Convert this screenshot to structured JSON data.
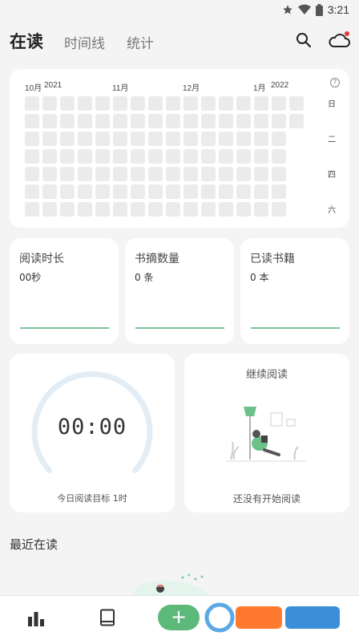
{
  "status_bar": {
    "time": "3:21"
  },
  "header": {
    "tabs": [
      {
        "label": "在读",
        "active": true
      },
      {
        "label": "时间线",
        "active": false
      },
      {
        "label": "统计",
        "active": false
      }
    ]
  },
  "heatmap": {
    "months": [
      "10月",
      "2021",
      "11月",
      "12月",
      "1月",
      "2022"
    ],
    "help_glyph": "?",
    "weekdays": [
      "日",
      "二",
      "四",
      "六"
    ]
  },
  "stats": [
    {
      "label": "阅读时长",
      "value": "00秒"
    },
    {
      "label": "书摘数量",
      "value": "0 条"
    },
    {
      "label": "已读书籍",
      "value": "0 本"
    }
  ],
  "timer": {
    "time": "00:00",
    "goal": "今日阅读目标 1时"
  },
  "continue_reading": {
    "title": "继续阅读",
    "empty_text": "还没有开始阅读"
  },
  "recent": {
    "title": "最近在读"
  },
  "bottom_nav": {
    "add_label": "+"
  },
  "colors": {
    "accent": "#5cb97a",
    "cell": "#ebebeb",
    "dial": "#e3edf5",
    "notify_dot": "#e53935"
  }
}
